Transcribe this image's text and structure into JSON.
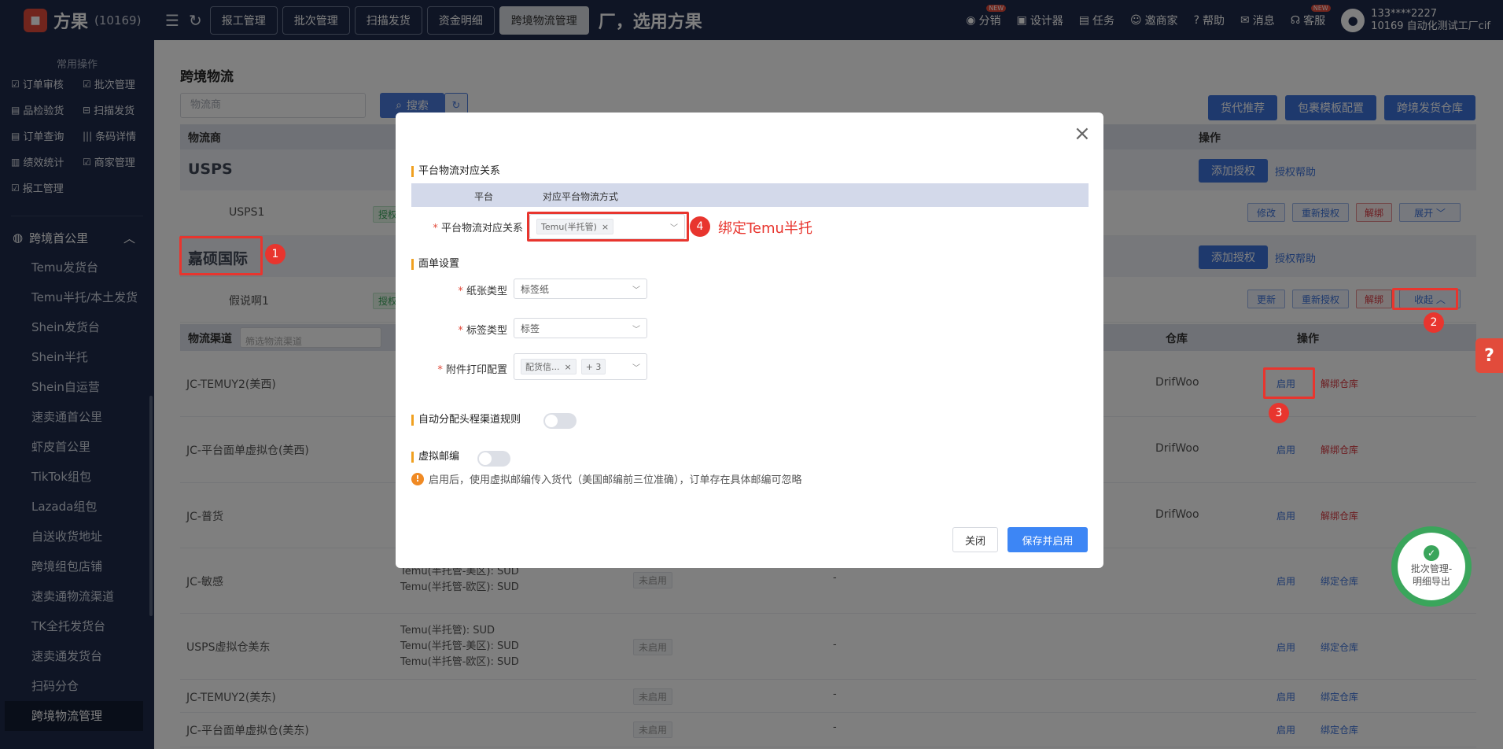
{
  "topbar": {
    "logo_text": "方果",
    "logo_sub": "(10169)",
    "nav": [
      "报工管理",
      "批次管理",
      "扫描发货",
      "资金明细",
      "跨境物流管理"
    ],
    "slogan": "厂，选用方果",
    "links": [
      {
        "label": "分销",
        "icon": "coin-icon",
        "new": "NEW"
      },
      {
        "label": "设计器",
        "icon": "image-icon",
        "new": ""
      },
      {
        "label": "任务",
        "icon": "task-icon",
        "new": ""
      },
      {
        "label": "邀商家",
        "icon": "people-icon",
        "new": ""
      },
      {
        "label": "帮助",
        "icon": "question-icon",
        "new": ""
      },
      {
        "label": "消息",
        "icon": "message-icon",
        "new": ""
      },
      {
        "label": "客服",
        "icon": "headset-icon",
        "new": "NEW"
      }
    ],
    "user_line1": "133****2227",
    "user_line2": "10169 自动化测试工厂cif"
  },
  "sidebar": {
    "title": "常用操作",
    "quick": [
      "订单审核",
      "批次管理",
      "品检验货",
      "扫描发货",
      "订单查询",
      "条码详情",
      "绩效统计",
      "商家管理",
      "报工管理"
    ],
    "group": "跨境首公里",
    "items": [
      "Temu发货台",
      "Temu半托/本土发货",
      "Shein发货台",
      "Shein半托",
      "Shein自运营",
      "速卖通首公里",
      "虾皮首公里",
      "TikTok组包",
      "Lazada组包",
      "自送收货地址",
      "跨境组包店铺",
      "速卖通物流渠道",
      "TK全托发货台",
      "速卖通发货台",
      "扫码分仓",
      "跨境物流管理"
    ]
  },
  "main": {
    "title": "跨境物流",
    "search_placeholder": "物流商",
    "search_label": "搜索",
    "actions": [
      "货代推荐",
      "包裹模板配置",
      "跨境发货仓库"
    ],
    "thead": {
      "carrier": "物流商",
      "op": "操作"
    },
    "carriers": [
      {
        "name": "USPS",
        "add": "添加授权",
        "help": "授权帮助",
        "sub": "USPS1",
        "status": "授权正常",
        "btns": [
          "修改",
          "重新授权",
          "解绑",
          "展开"
        ]
      },
      {
        "name": "嘉硕国际",
        "add": "添加授权",
        "help": "授权帮助",
        "sub": "假说啊1",
        "status": "授权正常",
        "btns": [
          "更新",
          "重新授权",
          "解绑",
          "收起"
        ]
      }
    ],
    "channel_head": {
      "channel": "物流渠道",
      "filter": "筛选物流渠道",
      "warehouse": "仓库",
      "op": "操作"
    },
    "channels": [
      {
        "name": "JC-TEMUY2(美西)",
        "map": [],
        "status": "",
        "dash": "",
        "wh": "DrifWoo",
        "op1": "启用",
        "op2": "解绑仓库"
      },
      {
        "name": "JC-平台面单虚拟仓(美西)",
        "map": [],
        "status": "",
        "dash": "",
        "wh": "DrifWoo",
        "op1": "启用",
        "op2": "解绑仓库"
      },
      {
        "name": "JC-普货",
        "map": [],
        "status": "",
        "dash": "",
        "wh": "DrifWoo",
        "op1": "启用",
        "op2": "解绑仓库"
      },
      {
        "name": "JC-敏感",
        "map": [
          "Temu(半托管-美区): SUD",
          "Temu(半托管-欧区): SUD"
        ],
        "status": "未启用",
        "dash": "-",
        "wh": "",
        "op1": "启用",
        "op2": "绑定仓库"
      },
      {
        "name": "USPS虚拟仓美东",
        "map": [
          "Temu(半托管): SUD",
          "Temu(半托管-美区): SUD",
          "Temu(半托管-欧区): SUD"
        ],
        "status": "未启用",
        "dash": "-",
        "wh": "",
        "op1": "启用",
        "op2": "绑定仓库"
      },
      {
        "name": "JC-TEMUY2(美东)",
        "map": [],
        "status": "未启用",
        "dash": "-",
        "wh": "",
        "op1": "启用",
        "op2": "绑定仓库"
      },
      {
        "name": "JC-平台面单虚拟仓(美东)",
        "map": [],
        "status": "未启用",
        "dash": "-",
        "wh": "",
        "op1": "启用",
        "op2": "绑定仓库"
      }
    ],
    "float_badge": "批次管理-明细导出"
  },
  "modal": {
    "sec1": "平台物流对应关系",
    "map_head": {
      "platform": "平台",
      "method": "对应平台物流方式"
    },
    "map_label": "平台物流对应关系",
    "map_chip": "Temu(半托管)",
    "sec2": "面单设置",
    "paper_label": "纸张类型",
    "paper_value": "标签纸",
    "label_label": "标签类型",
    "label_value": "标签",
    "attach_label": "附件打印配置",
    "attach_chip": "配货信...",
    "attach_more": "+ 3",
    "sec3": "自动分配头程渠道规则",
    "sec4": "虚拟邮编",
    "note": "启用后，使用虚拟邮编传入货代（美国邮编前三位准确），订单存在具体邮编可忽略",
    "close": "关闭",
    "save": "保存并启用"
  },
  "annotations": {
    "n1": "1",
    "n2": "2",
    "n3": "3",
    "n4": "4",
    "text4": "绑定Temu半托"
  }
}
